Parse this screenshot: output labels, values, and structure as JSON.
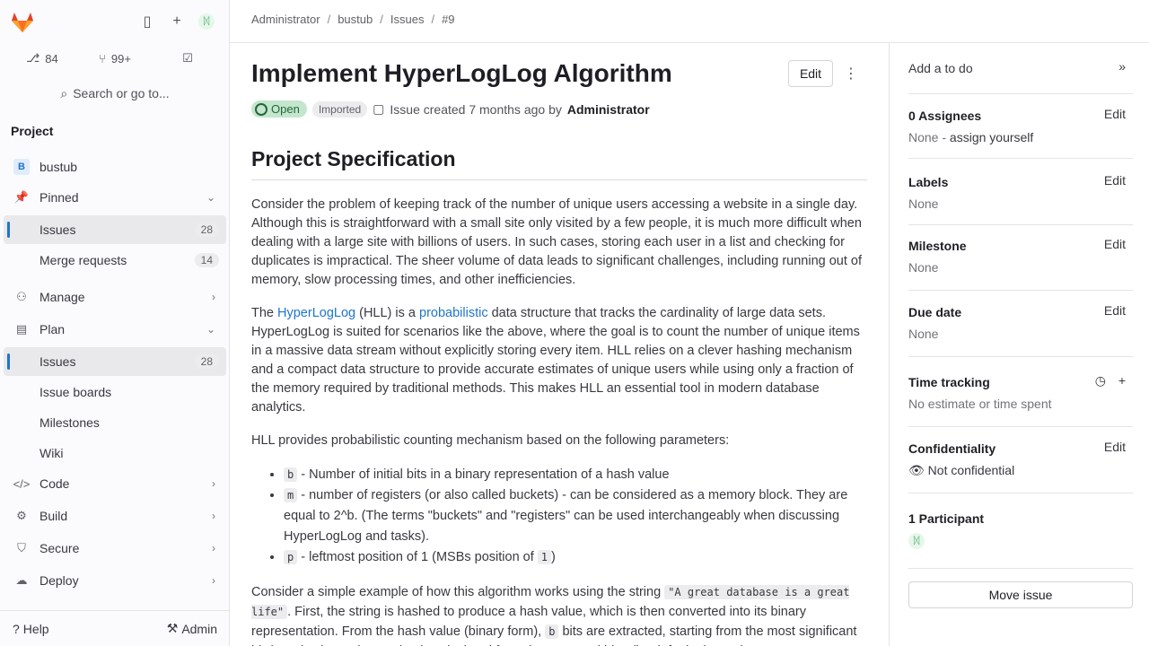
{
  "sidebar": {
    "counts": {
      "merge_requests": "84",
      "todos": "99+"
    },
    "search_label": "Search or go to...",
    "section_title": "Project",
    "project_name": "bustub",
    "project_initial": "B",
    "items": [
      {
        "label": "Pinned"
      },
      {
        "label": "Issues",
        "badge": "28"
      },
      {
        "label": "Merge requests",
        "badge": "14"
      },
      {
        "label": "Manage"
      },
      {
        "label": "Plan"
      },
      {
        "label": "Issues",
        "badge": "28"
      },
      {
        "label": "Issue boards"
      },
      {
        "label": "Milestones"
      },
      {
        "label": "Wiki"
      },
      {
        "label": "Code"
      },
      {
        "label": "Build"
      },
      {
        "label": "Secure"
      },
      {
        "label": "Deploy"
      }
    ],
    "help_label": "Help",
    "admin_label": "Admin"
  },
  "breadcrumb": [
    "Administrator",
    "bustub",
    "Issues",
    "#9"
  ],
  "issue": {
    "title": "Implement HyperLogLog Algorithm",
    "edit_label": "Edit",
    "status": "Open",
    "imported_label": "Imported",
    "created_text": "Issue created 7 months ago by",
    "author": "Administrator",
    "section_heading": "Project Specification",
    "para1": "Consider the problem of keeping track of the number of unique users accessing a website in a single day. Although this is straightforward with a small site only visited by a few people, it is much more difficult when dealing with a large site with billions of users. In such cases, storing each user in a list and checking for duplicates is impractical. The sheer volume of data leads to significant challenges, including running out of memory, slow processing times, and other inefficiencies.",
    "para2_a": "The ",
    "para2_link1": "HyperLogLog",
    "para2_b": " (HLL) is a ",
    "para2_link2": "probabilistic",
    "para2_c": " data structure that tracks the cardinality of large data sets. HyperLogLog is suited for scenarios like the above, where the goal is to count the number of unique items in a massive data stream without explicitly storing every item. HLL relies on a clever hashing mechanism and a compact data structure to provide accurate estimates of unique users while using only a fraction of the memory required by traditional methods. This makes HLL an essential tool in modern database analytics.",
    "para3": "HLL provides probabilistic counting mechanism based on the following parameters:",
    "params": [
      {
        "code": "b",
        "text": " - Number of initial bits in a binary representation of a hash value"
      },
      {
        "code": "m",
        "text": " - number of registers (or also called buckets) - can be considered as a memory block. They are equal to 2^b. (The terms \"buckets\" and \"registers\" can be used interchangeably when discussing HyperLogLog and tasks)."
      },
      {
        "code": "p",
        "text": " - leftmost position of 1 (MSBs position of ",
        "code2": "1",
        "text2": ")"
      }
    ],
    "para4_a": "Consider a simple example of how this algorithm works using the string ",
    "para4_code": "\"A great database is a great life\"",
    "para4_b": ". First, the string is hashed to produce a hash value, which is then converted into its binary representation. From the hash value (binary form), ",
    "para4_code2": "b",
    "para4_c": " bits are extracted, starting from the most significant bit (MSB). The register value is calculated from the extracted bits. (by default, the register"
  },
  "right_sidebar": {
    "todo_label": "Add a to do",
    "assignees_title": "0 Assignees",
    "assignees_value": "None - ",
    "assign_yourself": "assign yourself",
    "labels_title": "Labels",
    "milestone_title": "Milestone",
    "due_date_title": "Due date",
    "none": "None",
    "time_title": "Time tracking",
    "time_value": "No estimate or time spent",
    "confidentiality_title": "Confidentiality",
    "confidentiality_value": "Not confidential",
    "participants_title": "1 Participant",
    "edit_label": "Edit",
    "move_label": "Move issue"
  }
}
